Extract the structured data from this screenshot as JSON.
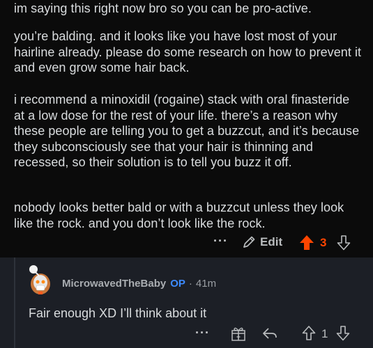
{
  "comment": {
    "paragraphs": [
      "im saying this right now bro so you can be pro-active.",
      "you’re balding. and it looks like you have lost most of your hairline already. please do some research on how to prevent it and even grow some hair back.",
      "i recommend a minoxidil (rogaine) stack with oral finasteride at a low dose for the rest of your life. there’s a reason why these people are telling you to get a buzzcut, and it’s because they subconsciously see that your hair is thinning and recessed, so their solution is to tell you buzz it off.",
      "nobody looks better bald or with a buzzcut unless they look like the rock. and you don’t look like the rock."
    ],
    "actions": {
      "more_label": "···",
      "edit_label": "Edit",
      "vote_count": "3",
      "upvote_color": "#ff4500"
    }
  },
  "reply": {
    "username": "MicrowavedTheBaby",
    "op_badge": "OP",
    "separator": "·",
    "age": "41m",
    "text": "Fair enough XD I’ll think about it",
    "actions": {
      "more_label": "···",
      "vote_count": "1",
      "icons": [
        "more-icon",
        "award-icon",
        "reply-icon",
        "upvote-icon",
        "downvote-icon"
      ]
    }
  },
  "colors": {
    "background": "#0b0b0b",
    "reply_background": "#1c1f26",
    "op_color": "#3d8bff"
  }
}
